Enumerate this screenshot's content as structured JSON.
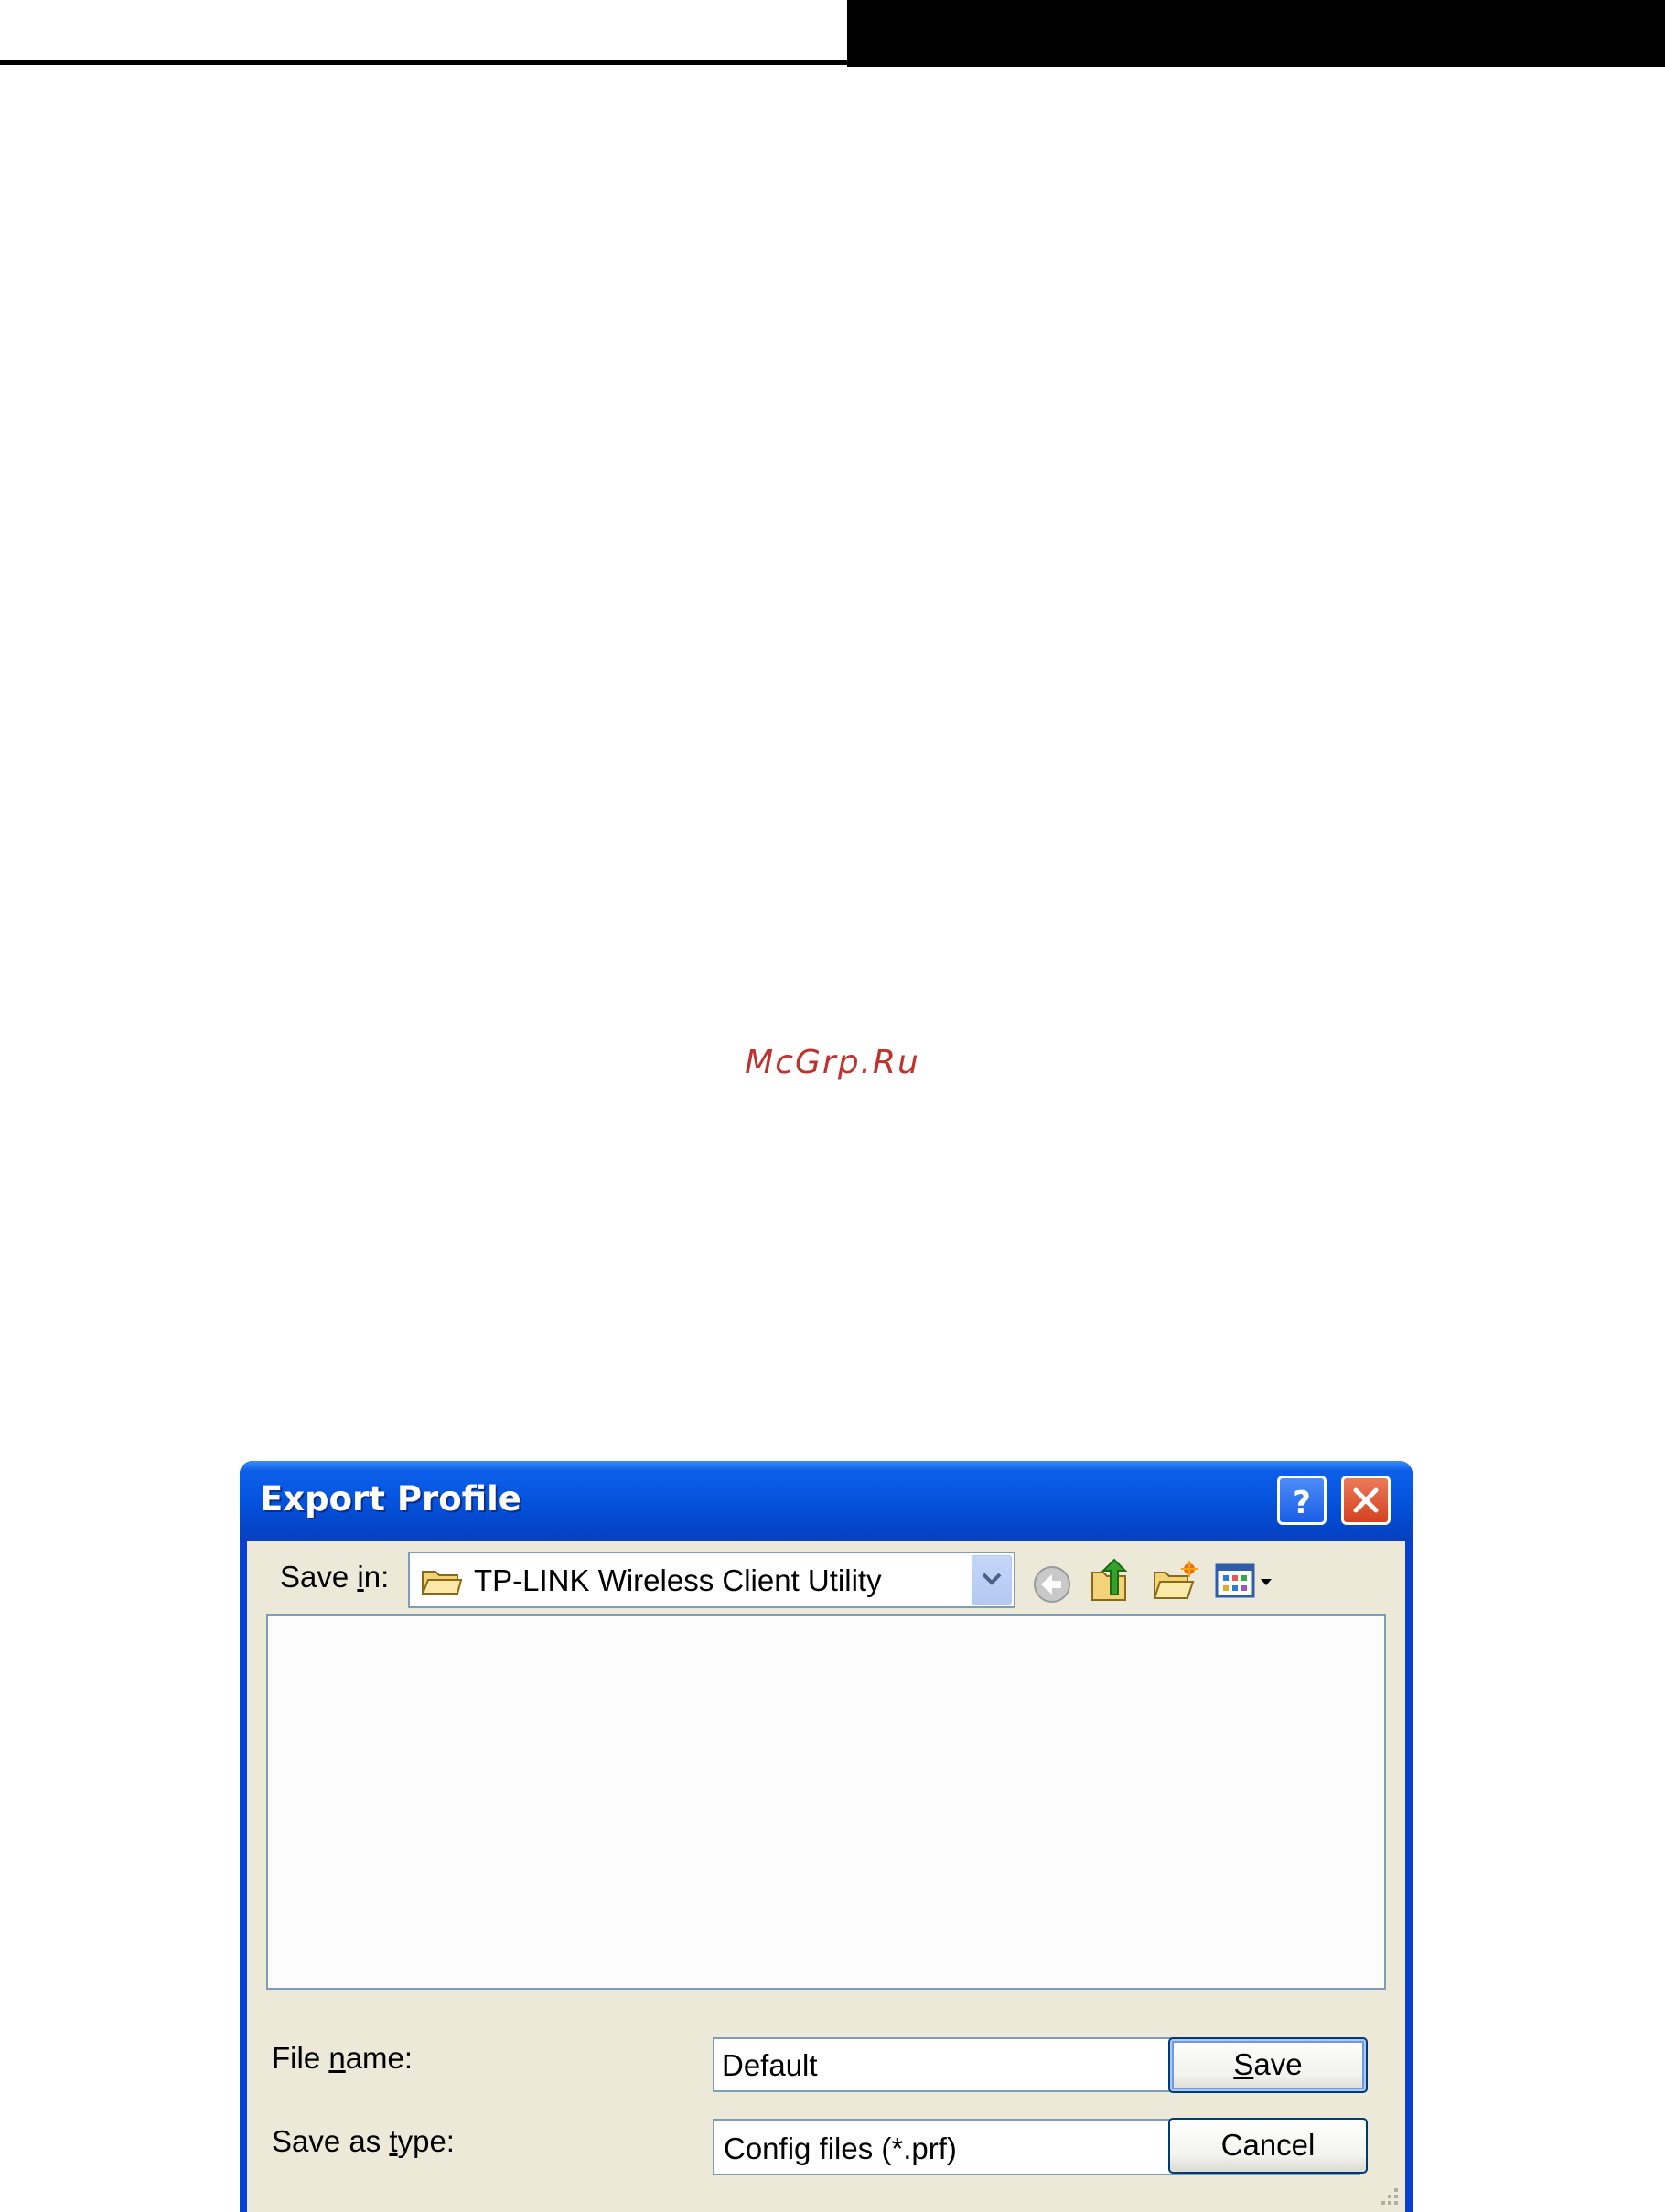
{
  "watermark": "McGrp.Ru",
  "dialog": {
    "title": "Export Profile",
    "save_in_label_pre": "Save ",
    "save_in_label_ul": "i",
    "save_in_label_post": "n:",
    "save_in_value": "TP-LINK Wireless Client Utility",
    "file_name_label_pre": "File ",
    "file_name_label_ul": "n",
    "file_name_label_post": "ame:",
    "file_name_value": "Default",
    "save_type_label_pre": "Save as ",
    "save_type_label_ul": "t",
    "save_type_label_post": "ype:",
    "save_type_value": "Config files (*.prf)",
    "save_button_ul": "S",
    "save_button_rest": "ave",
    "cancel_button": "Cancel"
  },
  "icons": {
    "folder": "folder-icon",
    "back": "back-arrow-icon",
    "up": "up-folder-icon",
    "new_folder": "new-folder-icon",
    "views": "views-menu-icon",
    "help": "help-icon",
    "close": "close-icon"
  },
  "colors": {
    "titlebar": "#0555e0",
    "dialog_face": "#ece9d8",
    "border": "#7f9db9",
    "watermark": "#c0322e"
  }
}
